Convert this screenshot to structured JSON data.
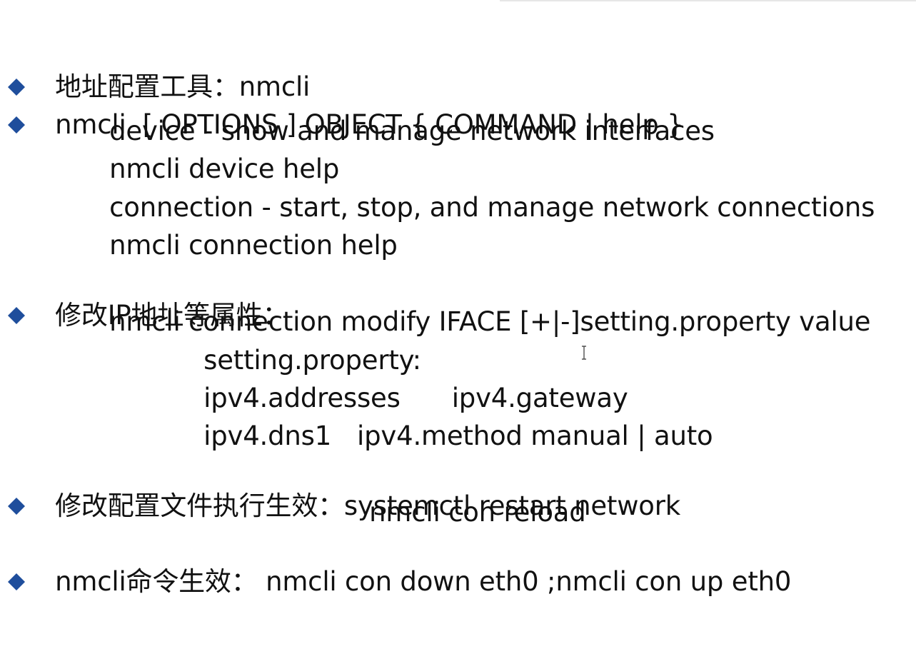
{
  "colors": {
    "bullet": "#1f4e9c",
    "text": "#111111",
    "background": "#ffffff"
  },
  "icons": {
    "bullet": "diamond-bullet-icon",
    "cursor": "text-cursor-icon"
  },
  "lines": [
    {
      "id": "l1",
      "bullet": true,
      "text": "地址配置工具：nmcli"
    },
    {
      "id": "l2",
      "bullet": true,
      "text": "nmcli  [ OPTIONS ] OBJECT { COMMAND | help }"
    },
    {
      "id": "l3",
      "bullet": false,
      "text": "device - show and manage network interfaces"
    },
    {
      "id": "l4",
      "bullet": false,
      "text": "nmcli device help"
    },
    {
      "id": "l5",
      "bullet": false,
      "text": "connection - start, stop, and manage network connections"
    },
    {
      "id": "l6",
      "bullet": false,
      "text": "nmcli connection help"
    },
    {
      "id": "l7",
      "bullet": true,
      "text": "修改IP地址等属性："
    },
    {
      "id": "l8",
      "bullet": false,
      "text": "nmcli connection modify IFACE [+|-]setting.property value"
    },
    {
      "id": "l9",
      "bullet": false,
      "text": "setting.property:"
    },
    {
      "id": "l10",
      "bullet": false,
      "a": "ipv4.addresses",
      "b": "ipv4.gateway"
    },
    {
      "id": "l11",
      "bullet": false,
      "a": "ipv4.dns1",
      "b": "ipv4.method manual | auto"
    },
    {
      "id": "l12",
      "bullet": true,
      "text": "修改配置文件执行生效：systemctl restart network"
    },
    {
      "id": "l13",
      "bullet": false,
      "text": "nmcli con reload"
    },
    {
      "id": "l14",
      "bullet": true,
      "text": "nmcli命令生效： nmcli con down eth0 ;nmcli con up eth0"
    }
  ]
}
